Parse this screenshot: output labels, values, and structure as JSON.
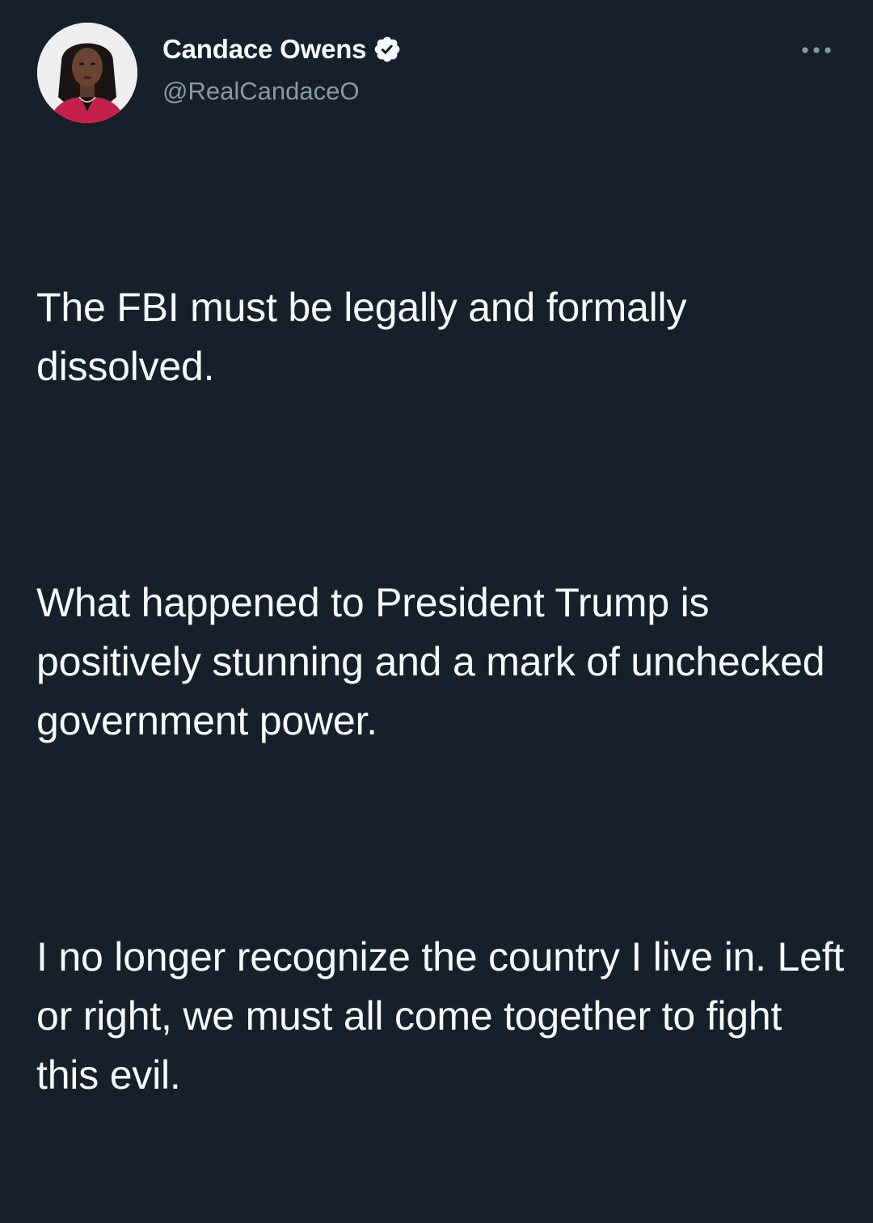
{
  "author": {
    "display_name": "Candace Owens",
    "handle": "@RealCandaceO",
    "verified": true,
    "verified_color": "#f7f9f9",
    "avatar_icon": "profile-photo"
  },
  "actions": {
    "more_icon": "more-horizontal-icon"
  },
  "tweet": {
    "paragraphs": [
      "The FBI must be legally and formally dissolved.",
      "What happened to President Trump is positively stunning and a mark of unchecked government power.",
      "I no longer recognize the country I live in. Left or right, we must all come together to fight this evil."
    ]
  },
  "colors": {
    "background": "#15202b",
    "text_primary": "#f7f9f9",
    "text_secondary": "#8b98a5"
  }
}
